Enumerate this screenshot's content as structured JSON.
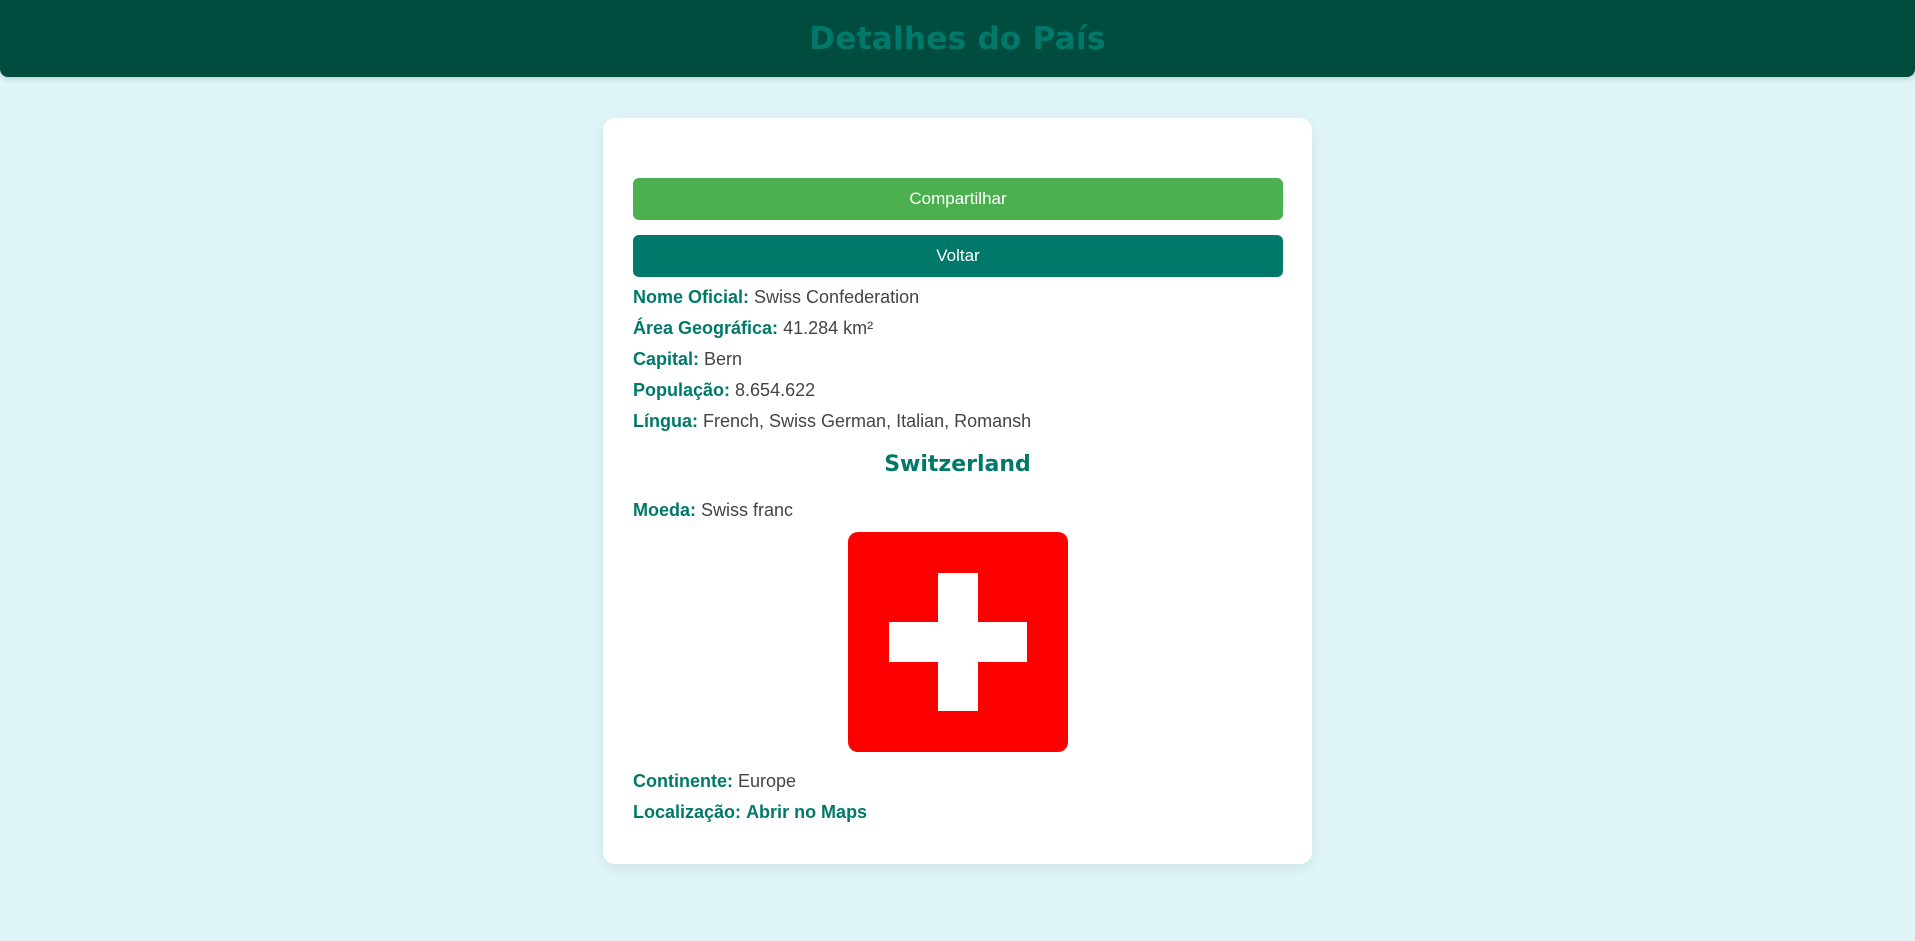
{
  "header": {
    "title": "Detalhes do País"
  },
  "actions": {
    "share_label": "Compartilhar",
    "back_label": "Voltar"
  },
  "details": {
    "official_name": {
      "label": "Nome Oficial:",
      "value": "Swiss Confederation"
    },
    "area": {
      "label": "Área Geográfica:",
      "value": "41.284 km²"
    },
    "capital": {
      "label": "Capital:",
      "value": "Bern"
    },
    "population": {
      "label": "População:",
      "value": "8.654.622"
    },
    "language": {
      "label": "Língua:",
      "value": "French, Swiss German, Italian, Romansh"
    },
    "country_name": "Switzerland",
    "currency": {
      "label": "Moeda:",
      "value": "Swiss franc"
    },
    "continent": {
      "label": "Continente:",
      "value": "Europe"
    },
    "location": {
      "label": "Localização:",
      "link_text": "Abrir no Maps"
    }
  },
  "flag": {
    "icon": "swiss-flag",
    "background_color": "#ff0000",
    "cross_color": "#ffffff"
  },
  "colors": {
    "page_background": "#dff5f8",
    "header_background": "#004d40",
    "accent": "#00796b",
    "share_button": "#4caf50",
    "back_button": "#00796b"
  }
}
